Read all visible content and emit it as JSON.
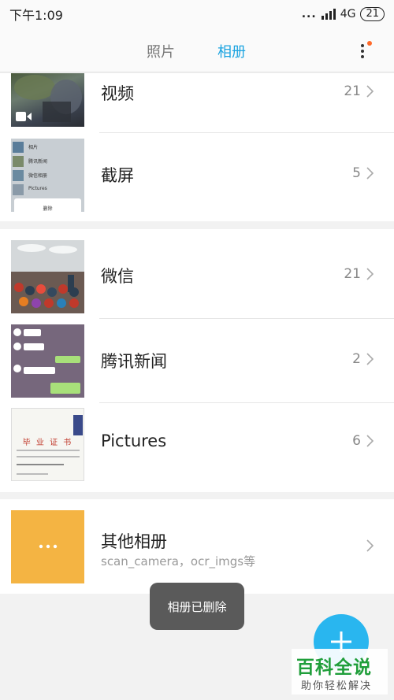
{
  "status_bar": {
    "time": "下午1:09",
    "network": "4G",
    "battery": "21"
  },
  "header": {
    "tab_photos": "照片",
    "tab_albums": "相册"
  },
  "albums": [
    {
      "label": "视频",
      "count": "21"
    },
    {
      "label": "截屏",
      "count": "5"
    },
    {
      "label": "微信",
      "count": "21"
    },
    {
      "label": "腾讯新闻",
      "count": "2"
    },
    {
      "label": "Pictures",
      "count": "6"
    },
    {
      "label": "其他相册",
      "sublabel": "scan_camera，ocr_imgs等"
    }
  ],
  "screenshot_thumb": {
    "item1": "相片",
    "item2": "腾讯新闻",
    "item3": "微信相册",
    "item4": "Pictures",
    "bottom": "删除"
  },
  "certificate_thumb": {
    "title": "毕 业 证 书"
  },
  "toast": "相册已删除",
  "watermark": {
    "title": "百科全说",
    "subtitle": "助你轻松解决"
  },
  "colors": {
    "accent": "#1aa3e0",
    "fab": "#29b6ef",
    "other_album_tile": "#f4b443",
    "badge": "#ff6a2a"
  }
}
